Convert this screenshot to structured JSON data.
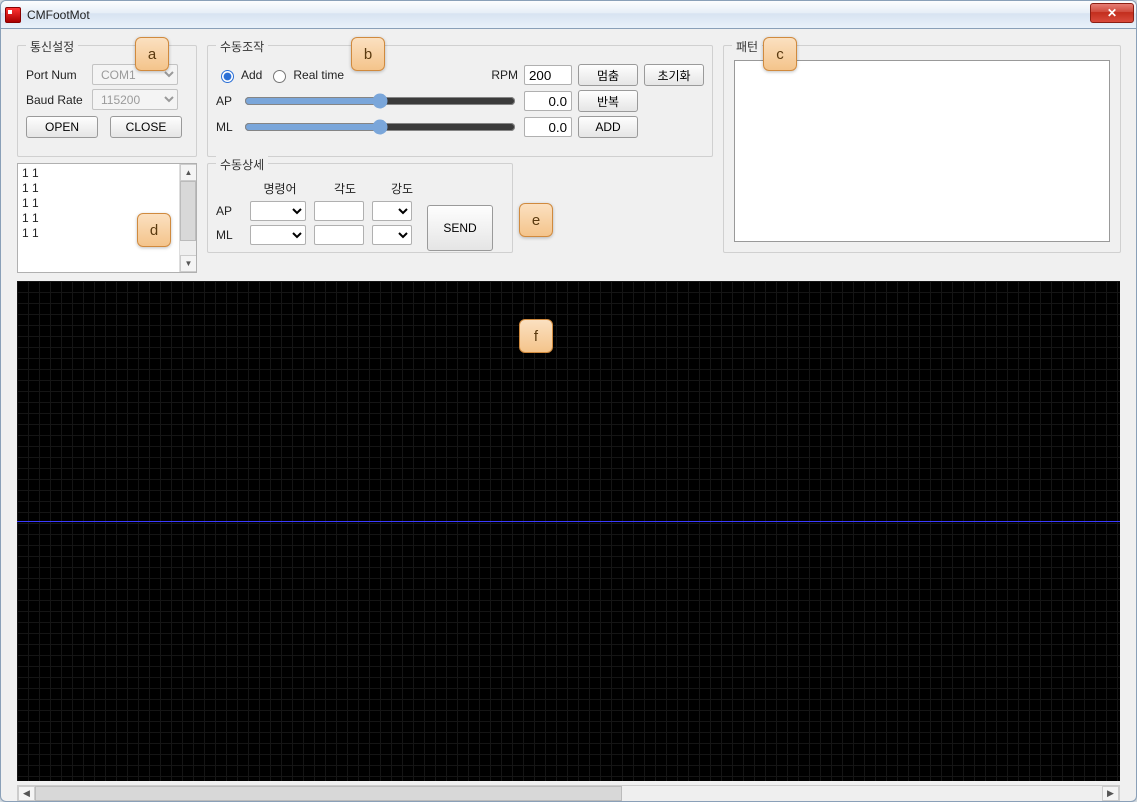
{
  "window": {
    "title": "CMFootMot"
  },
  "markers": {
    "a": "a",
    "b": "b",
    "c": "c",
    "d": "d",
    "e": "e",
    "f": "f"
  },
  "comm": {
    "legend": "통신설정",
    "port_label": "Port Num",
    "port_value": "COM1",
    "baud_label": "Baud Rate",
    "baud_value": "115200",
    "open": "OPEN",
    "close": "CLOSE"
  },
  "manual": {
    "legend": "수동조작",
    "mode_add": "Add",
    "mode_realtime": "Real time",
    "rpm_label": "RPM",
    "rpm_value": "200",
    "stop": "멈춤",
    "reset": "초기화",
    "ap_label": "AP",
    "ap_value": "0.0",
    "repeat": "반복",
    "ml_label": "ML",
    "ml_value": "0.0",
    "add": "ADD"
  },
  "detail": {
    "legend": "수동상세",
    "hdr_cmd": "명령어",
    "hdr_angle": "각도",
    "hdr_strength": "강도",
    "ap": "AP",
    "ml": "ML"
  },
  "send": "SEND",
  "pattern": {
    "legend": "패턴"
  },
  "list": {
    "items": [
      "1 1",
      "1 1",
      "1 1",
      "1 1",
      "1 1"
    ]
  }
}
